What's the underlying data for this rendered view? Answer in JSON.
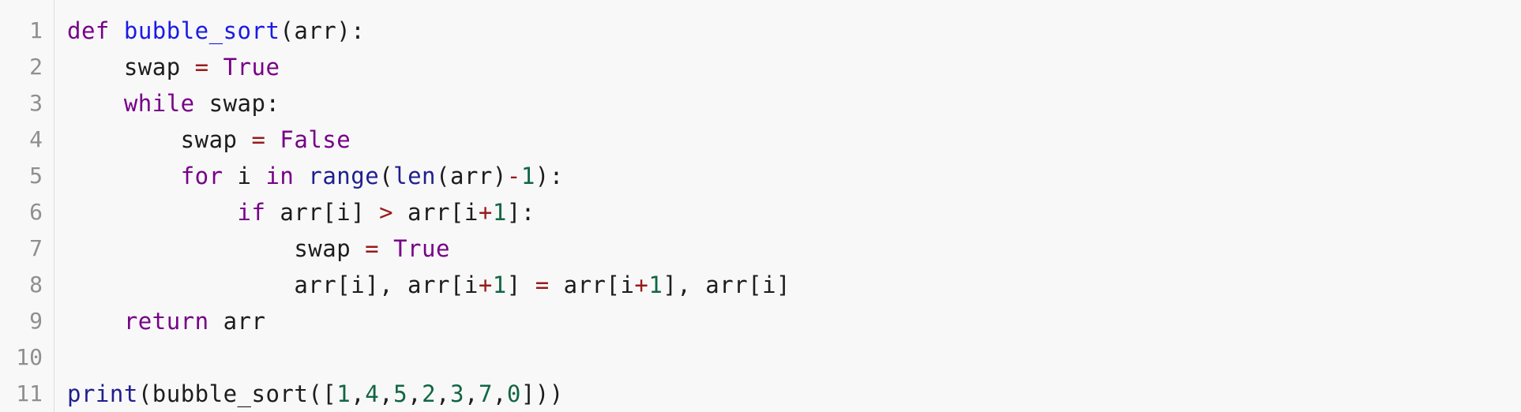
{
  "editor": {
    "line_numbers": [
      "1",
      "2",
      "3",
      "4",
      "5",
      "6",
      "7",
      "8",
      "9",
      "10",
      "11"
    ],
    "lines": [
      [
        {
          "t": "def",
          "c": "kw"
        },
        {
          "t": " ",
          "c": "var"
        },
        {
          "t": "bubble_sort",
          "c": "def"
        },
        {
          "t": "(arr):",
          "c": "var"
        }
      ],
      [
        {
          "t": "    swap ",
          "c": "var"
        },
        {
          "t": "=",
          "c": "op"
        },
        {
          "t": " ",
          "c": "var"
        },
        {
          "t": "True",
          "c": "kw"
        }
      ],
      [
        {
          "t": "    ",
          "c": "var"
        },
        {
          "t": "while",
          "c": "kw"
        },
        {
          "t": " swap:",
          "c": "var"
        }
      ],
      [
        {
          "t": "        swap ",
          "c": "var"
        },
        {
          "t": "=",
          "c": "op"
        },
        {
          "t": " ",
          "c": "var"
        },
        {
          "t": "False",
          "c": "kw"
        }
      ],
      [
        {
          "t": "        ",
          "c": "var"
        },
        {
          "t": "for",
          "c": "kw"
        },
        {
          "t": " i ",
          "c": "var"
        },
        {
          "t": "in",
          "c": "kw"
        },
        {
          "t": " ",
          "c": "var"
        },
        {
          "t": "range",
          "c": "builtin"
        },
        {
          "t": "(",
          "c": "var"
        },
        {
          "t": "len",
          "c": "builtin"
        },
        {
          "t": "(arr)",
          "c": "var"
        },
        {
          "t": "-",
          "c": "op"
        },
        {
          "t": "1",
          "c": "num"
        },
        {
          "t": "):",
          "c": "var"
        }
      ],
      [
        {
          "t": "            ",
          "c": "var"
        },
        {
          "t": "if",
          "c": "kw"
        },
        {
          "t": " arr[i] ",
          "c": "var"
        },
        {
          "t": ">",
          "c": "op"
        },
        {
          "t": " arr[i",
          "c": "var"
        },
        {
          "t": "+",
          "c": "op"
        },
        {
          "t": "1",
          "c": "num"
        },
        {
          "t": "]:",
          "c": "var"
        }
      ],
      [
        {
          "t": "                swap ",
          "c": "var"
        },
        {
          "t": "=",
          "c": "op"
        },
        {
          "t": " ",
          "c": "var"
        },
        {
          "t": "True",
          "c": "kw"
        }
      ],
      [
        {
          "t": "                arr[i], arr[i",
          "c": "var"
        },
        {
          "t": "+",
          "c": "op"
        },
        {
          "t": "1",
          "c": "num"
        },
        {
          "t": "] ",
          "c": "var"
        },
        {
          "t": "=",
          "c": "op"
        },
        {
          "t": " arr[i",
          "c": "var"
        },
        {
          "t": "+",
          "c": "op"
        },
        {
          "t": "1",
          "c": "num"
        },
        {
          "t": "], arr[i]",
          "c": "var"
        }
      ],
      [
        {
          "t": "    ",
          "c": "var"
        },
        {
          "t": "return",
          "c": "kw"
        },
        {
          "t": " arr",
          "c": "var"
        }
      ],
      [],
      [
        {
          "t": "print",
          "c": "builtin"
        },
        {
          "t": "(bubble_sort([",
          "c": "var"
        },
        {
          "t": "1",
          "c": "num"
        },
        {
          "t": ",",
          "c": "var"
        },
        {
          "t": "4",
          "c": "num"
        },
        {
          "t": ",",
          "c": "var"
        },
        {
          "t": "5",
          "c": "num"
        },
        {
          "t": ",",
          "c": "var"
        },
        {
          "t": "2",
          "c": "num"
        },
        {
          "t": ",",
          "c": "var"
        },
        {
          "t": "3",
          "c": "num"
        },
        {
          "t": ",",
          "c": "var"
        },
        {
          "t": "7",
          "c": "num"
        },
        {
          "t": ",",
          "c": "var"
        },
        {
          "t": "0",
          "c": "num"
        },
        {
          "t": "]))",
          "c": "var"
        }
      ]
    ]
  }
}
